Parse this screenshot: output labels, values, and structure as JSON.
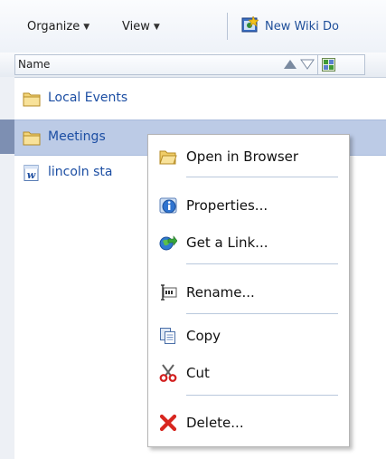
{
  "toolbar": {
    "organize_label": "Organize",
    "view_label": "View",
    "new_wiki_label": "New Wiki Do"
  },
  "column_header": {
    "name_label": "Name"
  },
  "items": [
    {
      "label": "Local Events",
      "icon": "folder-icon"
    },
    {
      "label": "Meetings",
      "icon": "folder-icon",
      "selected": true
    },
    {
      "label": "lincoln sta",
      "icon": "word-document-icon"
    }
  ],
  "context_menu": {
    "items": [
      {
        "label": "Open in Browser",
        "icon": "open-folder-icon"
      },
      {
        "label": "Properties...",
        "icon": "info-icon"
      },
      {
        "label": "Get a Link...",
        "icon": "link-icon"
      },
      {
        "label": "Rename...",
        "icon": "rename-icon"
      },
      {
        "label": "Copy",
        "icon": "copy-icon"
      },
      {
        "label": "Cut",
        "icon": "scissors-icon"
      },
      {
        "label": "Delete...",
        "icon": "delete-icon"
      }
    ]
  },
  "colors": {
    "link_blue": "#1c4ea3",
    "selected_row": "#bccbe6",
    "toolbar_border": "#c9d3e2"
  }
}
